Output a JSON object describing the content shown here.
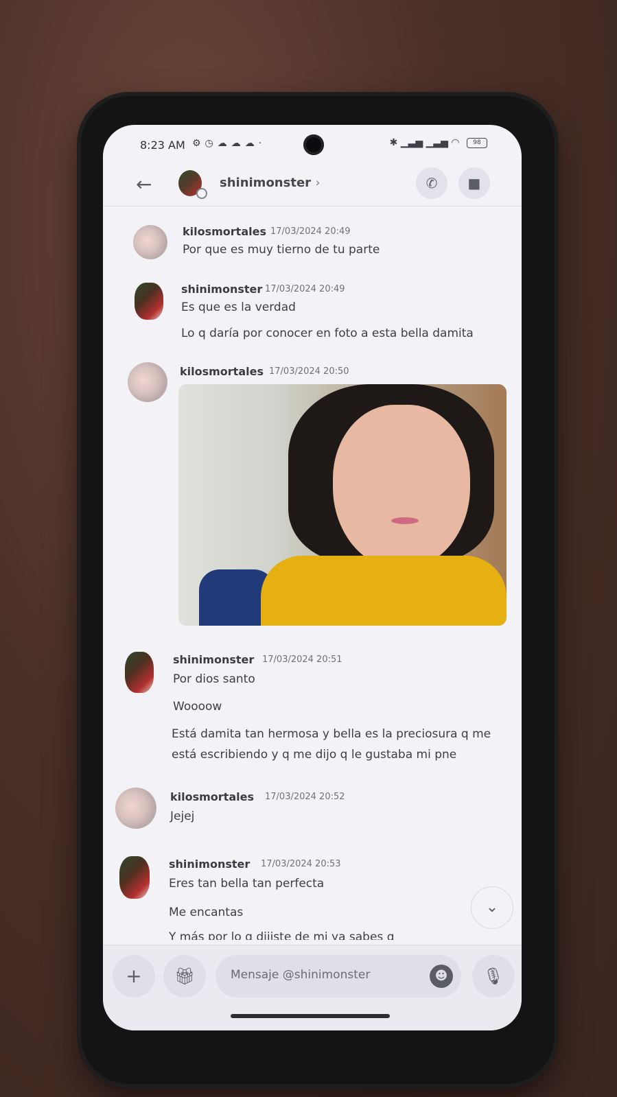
{
  "status_bar": {
    "time": "8:23 AM",
    "battery": "98"
  },
  "header": {
    "contact_name": "shinimonster",
    "chevron": "›"
  },
  "messages": [
    {
      "user": "kilosmortales",
      "timestamp": "17/03/2024 20:49",
      "lines": [
        "Por que es muy tierno de tu parte"
      ]
    },
    {
      "user": "shinimonster",
      "timestamp": "17/03/2024 20:49",
      "lines": [
        "Es que es la verdad",
        "Lo q daría por conocer en foto a esta bella damita"
      ]
    },
    {
      "user": "kilosmortales",
      "timestamp": "17/03/2024 20:50",
      "lines": [],
      "attachment": "photo"
    },
    {
      "user": "shinimonster",
      "timestamp": "17/03/2024 20:51",
      "lines": [
        "Por dios santo",
        "Woooow",
        "Está damita tan hermosa y bella es la preciosura q me",
        "está escribiendo y q me dijo q le gustaba mi pne"
      ]
    },
    {
      "user": "kilosmortales",
      "timestamp": "17/03/2024 20:52",
      "lines": [
        "Jejej"
      ]
    },
    {
      "user": "shinimonster",
      "timestamp": "17/03/2024 20:53",
      "lines": [
        "Eres tan bella tan perfecta",
        "Me encantas",
        "Y más por lo q dijiste de mi ya sabes q"
      ]
    }
  ],
  "composer": {
    "placeholder": "Mensaje @shinimonster"
  },
  "icons": {
    "back": "arrow-left-icon",
    "call": "phone-call-icon",
    "video": "video-camera-icon",
    "plus": "plus-icon",
    "gift": "gift-icon",
    "emoji": "emoji-icon",
    "mic": "microphone-icon",
    "scroll": "chevron-down-icon"
  }
}
